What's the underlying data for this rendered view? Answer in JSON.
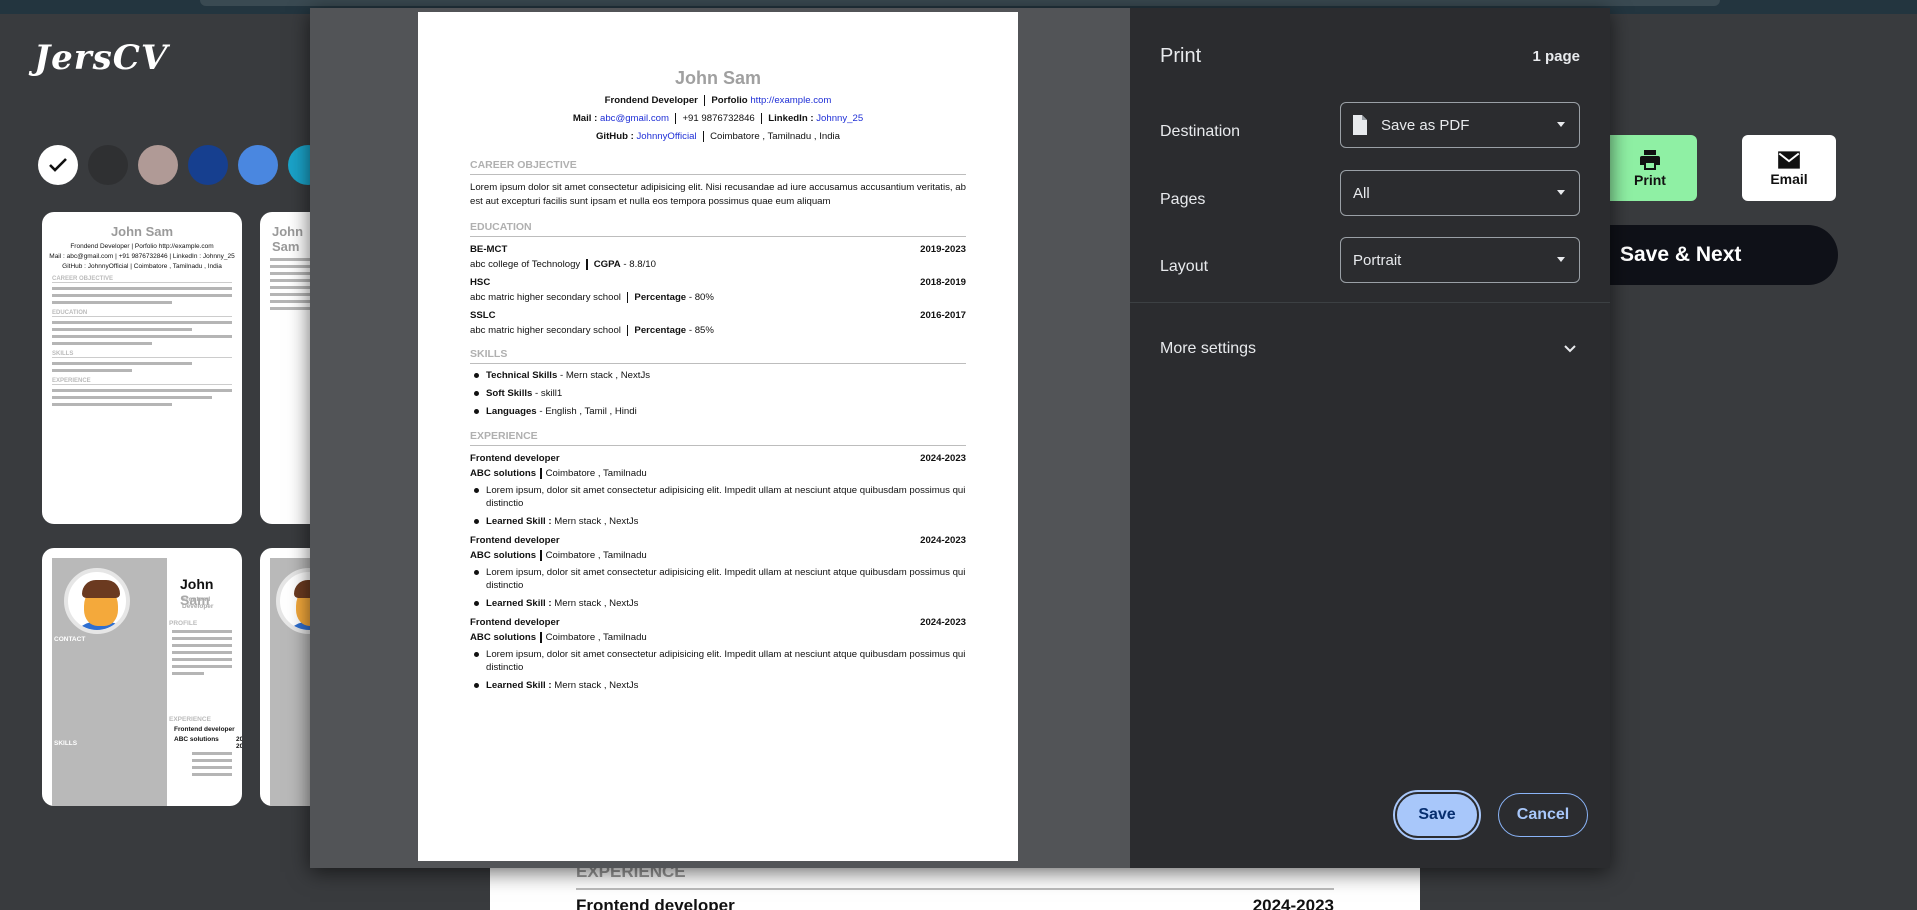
{
  "app": {
    "logo": "JersCV"
  },
  "colors": {
    "swatches": [
      "#ffffff",
      "#2f3032",
      "#b09a96",
      "#163f8f",
      "#4a87e0",
      "#1aa3c9"
    ]
  },
  "actions": {
    "print_label": "Print",
    "email_label": "Email",
    "save_next_label": "Save & Next"
  },
  "bg_doc": {
    "section": "EXPERIENCE",
    "role": "Frontend developer",
    "years": "2024-2023"
  },
  "thumb1": {
    "name": "John Sam",
    "line1": "Frondend Developer | Porfolio http://example.com",
    "line2": "Mail : abc@gmail.com | +91 9876732846 | LinkedIn : Johnny_25",
    "line3": "GitHub : JohnnyOfficial | Coimbatore , Tamilnadu , India",
    "sec1": "CAREER OBJECTIVE",
    "sec2": "EDUCATION",
    "sec3": "SKILLS",
    "sec4": "EXPERIENCE"
  },
  "thumb2": {
    "first": "John",
    "last": "Sam",
    "role": "Frontend Developer",
    "contact": "CONTACT",
    "profile": "PROFILE",
    "skills": "SKILLS",
    "exp": "EXPERIENCE",
    "company": "ABC solutions",
    "years": "2024-2023",
    "job": "Frontend developer"
  },
  "resume": {
    "name": "John Sam",
    "role_prefix": "Frondend Developer",
    "portfolio_label": "Porfolio",
    "portfolio_url": "http://example.com",
    "mail_label": "Mail :",
    "mail": "abc@gmail.com",
    "phone": "+91 9876732846",
    "linkedin_label": "LinkedIn :",
    "linkedin": "Johnny_25",
    "github_label": "GitHub :",
    "github": "JohnnyOfficial",
    "location": "Coimbatore , Tamilnadu , India",
    "objective_title": "CAREER OBJECTIVE",
    "objective": "Lorem ipsum dolor sit amet consectetur adipisicing elit. Nisi recusandae ad iure accusamus accusantium veritatis, ab est aut excepturi facilis sunt ipsam et nulla eos tempora possimus quae eum aliquam",
    "education_title": "EDUCATION",
    "education": [
      {
        "degree": "BE-MCT",
        "years": "2019-2023",
        "school": "abc college of Technology",
        "score_label": "CGPA",
        "score": "8.8/10"
      },
      {
        "degree": "HSC",
        "years": "2018-2019",
        "school": "abc matric higher secondary school",
        "score_label": "Percentage",
        "score": "80%"
      },
      {
        "degree": "SSLC",
        "years": "2016-2017",
        "school": "abc matric higher secondary school",
        "score_label": "Percentage",
        "score": "85%"
      }
    ],
    "skills_title": "SKILLS",
    "skills": [
      {
        "label": "Technical Skills",
        "value": "Mern stack ,  NextJs"
      },
      {
        "label": "Soft Skills",
        "value": "skill1"
      },
      {
        "label": "Languages",
        "value": "English , Tamil , Hindi"
      }
    ],
    "experience_title": "EXPERIENCE",
    "experience": [
      {
        "role": "Frontend developer",
        "years": "2024-2023",
        "company": "ABC solutions",
        "place": "Coimbatore , Tamilnadu",
        "desc": "Lorem ipsum, dolor sit amet consectetur adipisicing elit. Impedit ullam at nesciunt atque quibusdam possimus qui distinctio",
        "skill_label": "Learned Skill :",
        "skill": "Mern stack , NextJs"
      },
      {
        "role": "Frontend developer",
        "years": "2024-2023",
        "company": "ABC solutions",
        "place": "Coimbatore , Tamilnadu",
        "desc": "Lorem ipsum, dolor sit amet consectetur adipisicing elit. Impedit ullam at nesciunt atque quibusdam possimus qui distinctio",
        "skill_label": "Learned Skill :",
        "skill": "Mern stack , NextJs"
      },
      {
        "role": "Frontend developer",
        "years": "2024-2023",
        "company": "ABC solutions",
        "place": "Coimbatore , Tamilnadu",
        "desc": "Lorem ipsum, dolor sit amet consectetur adipisicing elit. Impedit ullam at nesciunt atque quibusdam possimus qui distinctio",
        "skill_label": "Learned Skill :",
        "skill": "Mern stack , NextJs"
      }
    ]
  },
  "print": {
    "title": "Print",
    "pages_count": "1 page",
    "destination_label": "Destination",
    "destination_value": "Save as PDF",
    "pages_label": "Pages",
    "pages_value": "All",
    "layout_label": "Layout",
    "layout_value": "Portrait",
    "more_settings": "More settings",
    "save": "Save",
    "cancel": "Cancel"
  }
}
